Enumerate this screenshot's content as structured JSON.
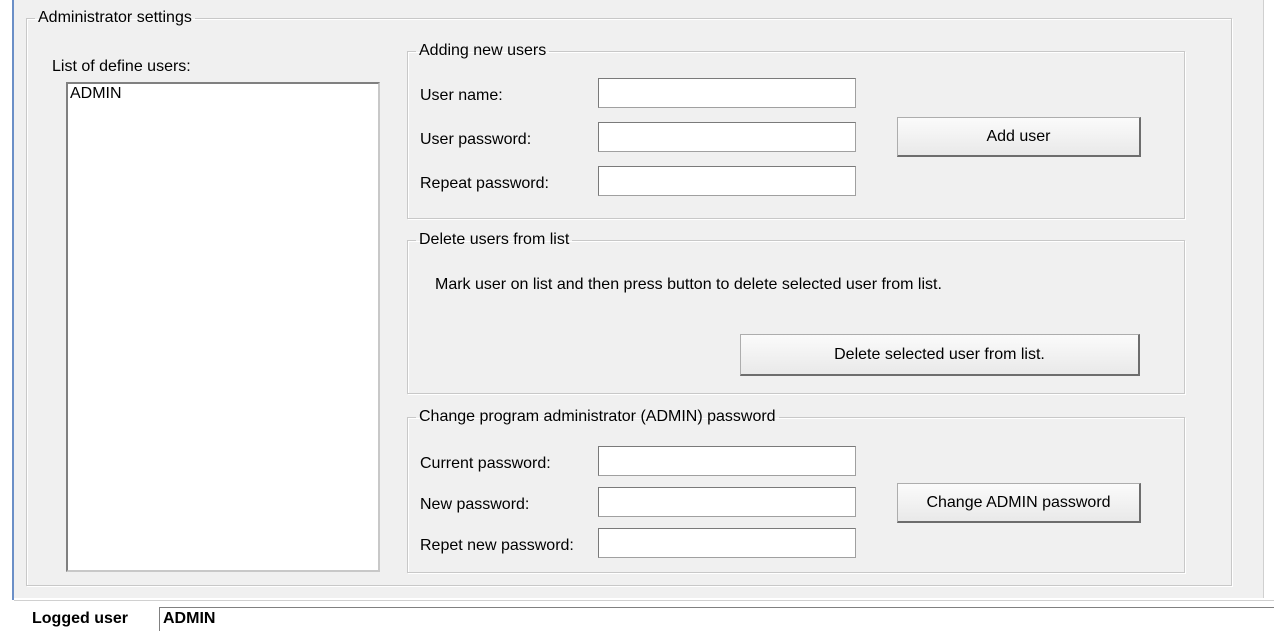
{
  "admin_settings": {
    "title": "Administrator settings",
    "users_list": {
      "label": "List of define users:",
      "items": [
        "ADMIN"
      ]
    },
    "adding_users": {
      "title": "Adding new users",
      "user_name_label": "User name:",
      "user_name_value": "",
      "user_password_label": "User password:",
      "user_password_value": "",
      "repeat_password_label": "Repeat password:",
      "repeat_password_value": "",
      "add_button": "Add user"
    },
    "delete_users": {
      "title": "Delete users from list",
      "instruction": "Mark user on list and then press button to delete selected user from list.",
      "delete_button": "Delete selected user from list."
    },
    "change_admin": {
      "title": "Change program administrator (ADMIN) password",
      "current_password_label": "Current password:",
      "current_password_value": "",
      "new_password_label": "New password:",
      "new_password_value": "",
      "repeat_new_password_label": "Repet new password:",
      "repeat_new_password_value": "",
      "change_button": "Change ADMIN password"
    }
  },
  "status_bar": {
    "label": "Logged user",
    "value": "ADMIN"
  },
  "colors": {
    "panel_background": "#f0f0f0",
    "window_edge": "#6b8fc7"
  }
}
